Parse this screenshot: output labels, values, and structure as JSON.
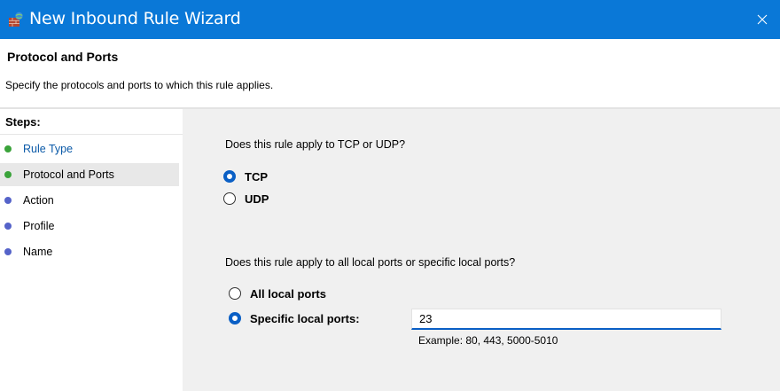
{
  "window": {
    "title": "New Inbound Rule Wizard",
    "app_icon": "firewall-icon",
    "close_glyph": "✕",
    "accent": "#0a78d7"
  },
  "header": {
    "title": "Protocol and Ports",
    "subtitle": "Specify the protocols and ports to which this rule applies."
  },
  "steps": {
    "title": "Steps:",
    "items": [
      {
        "label": "Rule Type",
        "state": "done",
        "dot_color": "#3aa33a"
      },
      {
        "label": "Protocol and Ports",
        "state": "current",
        "dot_color": "#3aa33a"
      },
      {
        "label": "Action",
        "state": "pending",
        "dot_color": "#5563c9"
      },
      {
        "label": "Profile",
        "state": "pending",
        "dot_color": "#5563c9"
      },
      {
        "label": "Name",
        "state": "pending",
        "dot_color": "#5563c9"
      }
    ]
  },
  "protocol": {
    "question": "Does this rule apply to TCP or UDP?",
    "options": [
      {
        "label": "TCP",
        "checked": true
      },
      {
        "label": "UDP",
        "checked": false
      }
    ]
  },
  "ports": {
    "question": "Does this rule apply to all local ports or specific local ports?",
    "options": [
      {
        "label": "All local ports",
        "checked": false
      },
      {
        "label": "Specific local ports:",
        "checked": true
      }
    ],
    "input_value": "23",
    "example": "Example: 80, 443, 5000-5010"
  }
}
